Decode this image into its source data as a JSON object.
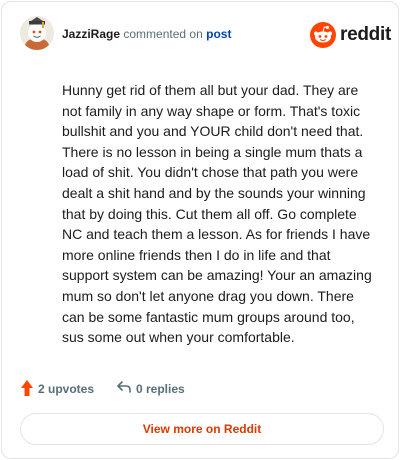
{
  "comment": {
    "username": "JazziRage",
    "verb": "commented on",
    "post_link": "post",
    "body": "Hunny get rid of them all but your dad. They are not family in any way shape or form. That's toxic bullshit and you and YOUR child don't need that. There is no lesson in being a single mum thats a load of shit. You didn't chose that path you were dealt a shit hand and by the sounds your winning that by doing this. Cut them all off. Go complete NC and teach them a lesson. As for friends I have more online friends then I do in life and that support system can be amazing! Your an amazing mum so don't let anyone drag you down. There can be some fantastic mum groups around too, sus some out when your comfortable."
  },
  "brand": {
    "name": "reddit",
    "icon": "reddit-logo-icon",
    "color": "#ff4500"
  },
  "actions": {
    "upvotes_label": "2 upvotes",
    "upvote_icon": "upvote-arrow-icon",
    "replies_label": "0 replies",
    "reply_icon": "reply-arrow-icon"
  },
  "cta": {
    "label": "View more on Reddit",
    "color": "#d93a00"
  }
}
